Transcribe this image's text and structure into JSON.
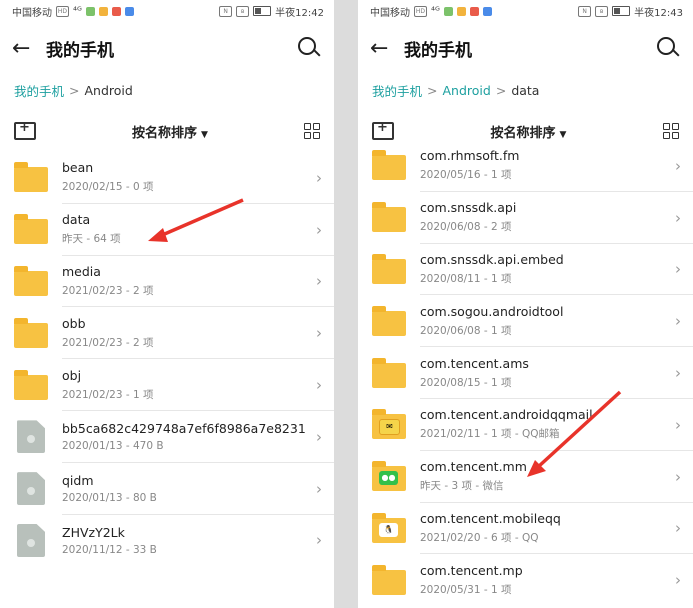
{
  "left_screen": {
    "status": {
      "carrier": "中国移动",
      "hd": "HD",
      "signal": "⁴ᴳ",
      "time": "半夜12:42"
    },
    "back_icon": "back-arrow-icon",
    "title": "我的手机",
    "breadcrumb": {
      "root": "我的手机",
      "separator": ">",
      "current": "Android"
    },
    "sort_label": "按名称排序",
    "sort_caret": "▼",
    "chevron": "›",
    "items": [
      {
        "name": "bean",
        "meta": "2020/02/15 - 0 项",
        "type": "folder"
      },
      {
        "name": "data",
        "meta": "昨天 - 64 项",
        "type": "folder"
      },
      {
        "name": "media",
        "meta": "2021/02/23 - 2 项",
        "type": "folder"
      },
      {
        "name": "obb",
        "meta": "2021/02/23 - 2 项",
        "type": "folder"
      },
      {
        "name": "obj",
        "meta": "2021/02/23 - 1 项",
        "type": "folder"
      },
      {
        "name": "bb5ca682c429748a7ef6f8986a7e8231",
        "meta": "2020/01/13 - 470 B",
        "type": "file"
      },
      {
        "name": "qidm",
        "meta": "2020/01/13 - 80 B",
        "type": "file"
      },
      {
        "name": "ZHVzY2Lk",
        "meta": "2020/11/12 - 33 B",
        "type": "file"
      }
    ]
  },
  "right_screen": {
    "status": {
      "carrier": "中国移动",
      "hd": "HD",
      "signal": "⁴ᴳ",
      "time": "半夜12:43"
    },
    "title": "我的手机",
    "breadcrumb": {
      "root": "我的手机",
      "separator": ">",
      "mid": "Android",
      "separator2": ">",
      "current": "data"
    },
    "sort_label": "按名称排序",
    "sort_caret": "▼",
    "chevron": "›",
    "items": [
      {
        "name": "com.rhmsoft.fm",
        "meta": "2020/05/16 - 1 项",
        "type": "folder"
      },
      {
        "name": "com.snssdk.api",
        "meta": "2020/06/08 - 2 项",
        "type": "folder"
      },
      {
        "name": "com.snssdk.api.embed",
        "meta": "2020/08/11 - 1 项",
        "type": "folder"
      },
      {
        "name": "com.sogou.androidtool",
        "meta": "2020/06/08 - 1 项",
        "type": "folder"
      },
      {
        "name": "com.tencent.ams",
        "meta": "2020/08/15 - 1 项",
        "type": "folder"
      },
      {
        "name": "com.tencent.androidqqmail",
        "meta": "2021/02/11 - 1 项 - QQ邮箱",
        "type": "folder",
        "badge": "mail"
      },
      {
        "name": "com.tencent.mm",
        "meta": "昨天 - 3 项 - 微信",
        "type": "folder",
        "badge": "wechat"
      },
      {
        "name": "com.tencent.mobileqq",
        "meta": "2021/02/20 - 6 项 - QQ",
        "type": "folder",
        "badge": "qq"
      },
      {
        "name": "com.tencent.mp",
        "meta": "2020/05/31 - 1 项",
        "type": "folder"
      }
    ]
  },
  "colors": {
    "accent": "#1ea0a0",
    "folder": "#f7c242",
    "annotation_arrow": "#e8332a"
  }
}
